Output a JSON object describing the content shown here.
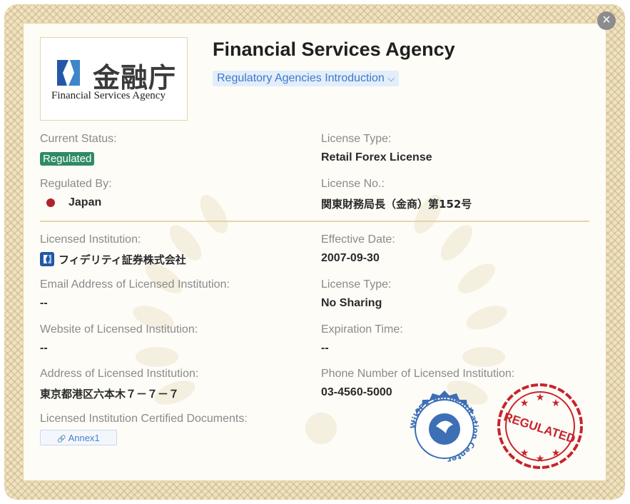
{
  "close_button": {
    "symbol": "×"
  },
  "logo": {
    "kanji": "金融庁",
    "english": "Financial Services Agency"
  },
  "agency": {
    "name": "Financial Services Agency",
    "intro_label": "Regulatory Agencies Introduction",
    "intro_chevron": "⌵"
  },
  "fields": {
    "current_status_label": "Current Status:",
    "current_status_value": "Regulated",
    "license_type_label": "License Type:",
    "license_type_value": "Retail Forex License",
    "regulated_by_label": "Regulated By:",
    "regulated_by_value": "Japan",
    "license_no_label": "License No.:",
    "license_no_value": "関東財務局長（金商）第152号",
    "licensed_institution_label": "Licensed Institution:",
    "licensed_institution_value": "フィデリティ証券株式会社",
    "effective_date_label": "Effective Date:",
    "effective_date_value": "2007-09-30",
    "email_label": "Email Address of Licensed Institution:",
    "email_value": "--",
    "license_type2_label": "License Type:",
    "license_type2_value": "No Sharing",
    "website_label": "Website of Licensed Institution:",
    "website_value": "--",
    "expiration_label": "Expiration Time:",
    "expiration_value": "--",
    "address_label": "Address of Licensed Institution:",
    "address_value": "東京都港区六本木７－７－７",
    "phone_label": "Phone Number of Licensed Institution:",
    "phone_value": "03-4560-5000",
    "documents_label": "Licensed Institution Certified Documents:",
    "annex_label": "Annex1",
    "annex_icon": "🔗"
  },
  "seals": {
    "authentication_text": "WikiFX Authentication Center",
    "regulated_text": "REGULATED"
  },
  "colors": {
    "status_green": "#2f8a66",
    "link_blue": "#3f78c8",
    "japan_red": "#b0222d",
    "seal_blue": "#3d6fb4",
    "seal_red": "#c8232c"
  }
}
